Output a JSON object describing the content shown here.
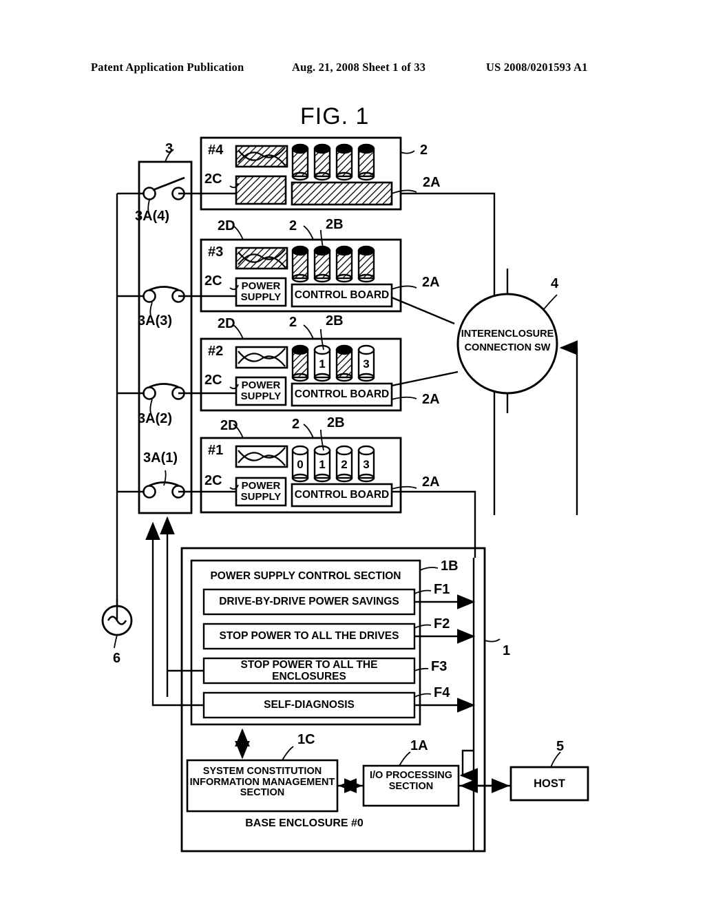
{
  "header": {
    "left": "Patent Application Publication",
    "center": "Aug. 21, 2008  Sheet 1 of 33",
    "right": "US 2008/0201593 A1"
  },
  "figure": {
    "title": "FIG. 1"
  },
  "switch_panel": {
    "ref": "3",
    "switches": [
      {
        "label": "3A(4)",
        "state": "open"
      },
      {
        "label": "3A(3)",
        "state": "closed"
      },
      {
        "label": "3A(2)",
        "state": "closed"
      },
      {
        "label": "3A(1)",
        "state": "closed"
      }
    ]
  },
  "power_source": {
    "ref": "6",
    "icon": "ac-source-icon"
  },
  "interenclosure_switch": {
    "ref": "4",
    "line1": "INTERENCLOSURE",
    "line2": "CONNECTION SW"
  },
  "enclosure_refs": {
    "enclosure": "2",
    "control_board": "2A",
    "drive": "2B",
    "power_supply": "2C",
    "fan": "2D"
  },
  "enclosures": [
    {
      "id": "#4",
      "shaded": true,
      "power_supply_label": "",
      "control_board_label": "",
      "drives": [
        {
          "label": "",
          "shaded": true
        },
        {
          "label": "",
          "shaded": true
        },
        {
          "label": "",
          "shaded": true
        },
        {
          "label": "",
          "shaded": true
        }
      ]
    },
    {
      "id": "#3",
      "shaded": true,
      "power_supply_label": "POWER SUPPLY",
      "control_board_label": "CONTROL BOARD",
      "drives": [
        {
          "label": "",
          "shaded": true
        },
        {
          "label": "",
          "shaded": true
        },
        {
          "label": "",
          "shaded": true
        },
        {
          "label": "",
          "shaded": true
        }
      ]
    },
    {
      "id": "#2",
      "shaded": false,
      "power_supply_label": "POWER SUPPLY",
      "control_board_label": "CONTROL BOARD",
      "drives": [
        {
          "label": "",
          "shaded": true
        },
        {
          "label": "1",
          "shaded": false
        },
        {
          "label": "",
          "shaded": true
        },
        {
          "label": "3",
          "shaded": false
        }
      ]
    },
    {
      "id": "#1",
      "shaded": false,
      "power_supply_label": "POWER SUPPLY",
      "control_board_label": "CONTROL BOARD",
      "drives": [
        {
          "label": "0",
          "shaded": false
        },
        {
          "label": "1",
          "shaded": false
        },
        {
          "label": "2",
          "shaded": false
        },
        {
          "label": "3",
          "shaded": false
        }
      ]
    }
  ],
  "base_enclosure": {
    "ref": "1",
    "caption": "BASE ENCLOSURE #0",
    "power_supply_control_section": {
      "ref": "1B",
      "title": "POWER SUPPLY CONTROL SECTION",
      "functions": [
        {
          "ref": "F1",
          "label": "DRIVE-BY-DRIVE POWER SAVINGS"
        },
        {
          "ref": "F2",
          "label": "STOP POWER TO ALL THE DRIVES"
        },
        {
          "ref": "F3",
          "label": "STOP POWER TO ALL THE ENCLOSURES"
        },
        {
          "ref": "F4",
          "label": "SELF-DIAGNOSIS"
        }
      ]
    },
    "system_constitution": {
      "ref": "1C",
      "line1": "SYSTEM CONSTITUTION",
      "line2": "INFORMATION MANAGEMENT",
      "line3": "SECTION"
    },
    "io_processing": {
      "ref": "1A",
      "line1": "I/O PROCESSING",
      "line2": "SECTION"
    }
  },
  "host": {
    "ref": "5",
    "label": "HOST"
  }
}
